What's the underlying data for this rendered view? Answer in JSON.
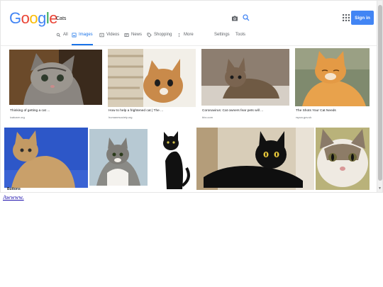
{
  "header": {
    "logo_letters": [
      "G",
      "o",
      "o",
      "g",
      "l",
      "e"
    ],
    "logo_colors": [
      "#4285f4",
      "#ea4335",
      "#fbbc05",
      "#4285f4",
      "#34a853",
      "#ea4335"
    ],
    "search_value": "Cats",
    "signin_label": "Sign in",
    "accent": "#4285f4"
  },
  "tabs": {
    "all": "All",
    "images": "Images",
    "videos": "Videos",
    "news": "News",
    "shopping": "Shopping",
    "more": "More",
    "settings": "Settings",
    "tools": "Tools",
    "active": "Images"
  },
  "results": [
    {
      "caption": "Thinking of getting a cat ...",
      "source": "icatcare.org"
    },
    {
      "caption": "How to help a frightened cat | The ...",
      "source": "humanesociety.org"
    },
    {
      "caption": "Coronavirus: Cat owners fear pets will ...",
      "source": "bbc.com"
    },
    {
      "caption": "The Shots Your Cat Needs",
      "source": "rspca.gov.uk"
    }
  ],
  "second_row_caption": "Buttons",
  "link_text": "Awwww."
}
